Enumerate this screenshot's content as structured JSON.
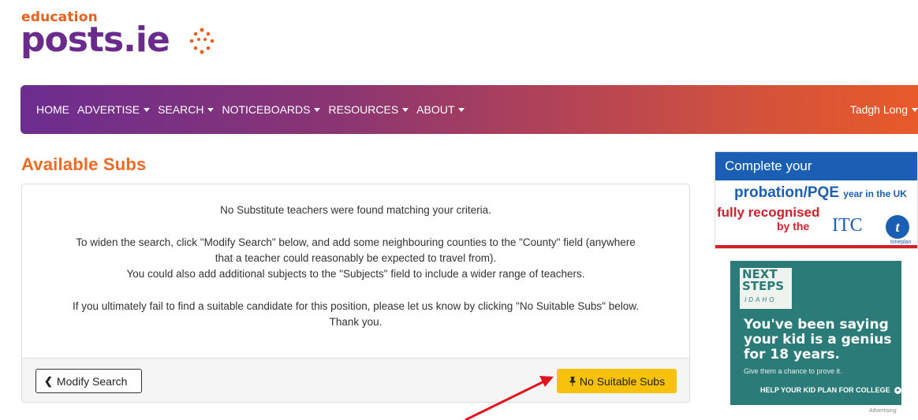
{
  "logo": {
    "education": "education",
    "posts": "posts",
    "ie": ".ie"
  },
  "nav": {
    "items": [
      {
        "label": "HOME",
        "dropdown": false
      },
      {
        "label": "ADVERTISE",
        "dropdown": true
      },
      {
        "label": "SEARCH",
        "dropdown": true
      },
      {
        "label": "NOTICEBOARDS",
        "dropdown": true
      },
      {
        "label": "RESOURCES",
        "dropdown": true
      },
      {
        "label": "ABOUT",
        "dropdown": true
      }
    ],
    "user": "Tadgh Long"
  },
  "main": {
    "title": "Available Subs",
    "messages": [
      "No Substitute teachers were found matching your criteria.",
      "To widen the search, click \"Modify Search\" below, and add some neighbouring counties to the \"County\" field (anywhere",
      "that a teacher could reasonably be expected to travel from).",
      "You could also add additional subjects to the \"Subjects\" field to include a wider range of teachers.",
      "If you ultimately fail to find a suitable candidate for this position, please let us know by clicking \"No Suitable Subs\" below.",
      "Thank you."
    ],
    "modify_button": "Modify Search",
    "no_subs_button": "No Suitable Subs"
  },
  "ads": {
    "ad1": {
      "header": "Complete your",
      "line1": "probation/PQE",
      "line1_small": "year in the UK",
      "line2": "fully recognised",
      "line3": "by the",
      "itc": "ITC",
      "logo_letter": "t",
      "brand": "timeplan"
    },
    "ad2": {
      "next": "NEXT",
      "steps": "STEPS",
      "idaho": "IDAHO",
      "headline": "You've been saying your kid is a genius for 18 years.",
      "sub": "Give them a chance to prove it.",
      "cta": "HELP YOUR KID PLAN FOR COLLEGE",
      "advertising": "Advertising"
    }
  },
  "colors": {
    "brand_purple": "#6a2c8c",
    "brand_orange": "#ee6a22",
    "button_yellow": "#f7c10c",
    "annotation_red": "#e0141e"
  }
}
